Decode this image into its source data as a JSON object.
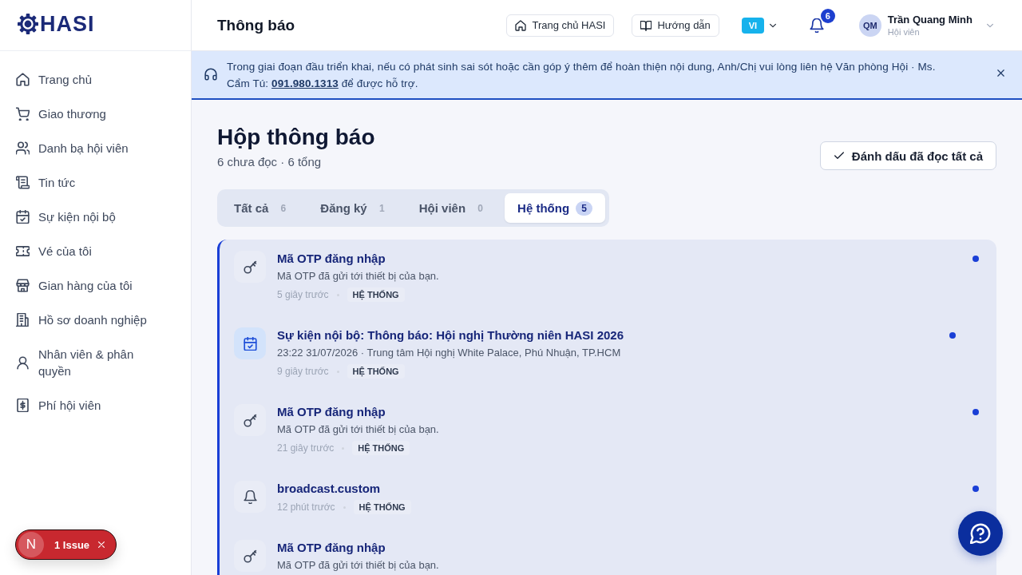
{
  "logo": {
    "text": "HASI"
  },
  "sidebar": {
    "items": [
      {
        "label": "Trang chủ",
        "selected": false
      },
      {
        "label": "Giao thương",
        "selected": false
      },
      {
        "label": "Danh bạ hội viên",
        "selected": false
      },
      {
        "label": "Tin tức",
        "selected": false
      },
      {
        "label": "Sự kiện nội bộ",
        "selected": false
      },
      {
        "label": "Vé của tôi",
        "selected": false
      },
      {
        "label": "Gian hàng của tôi",
        "selected": false
      },
      {
        "label": "Hồ sơ doanh nghiệp",
        "selected": false
      },
      {
        "label": "Nhân viên & phân quyền",
        "selected": false
      },
      {
        "label": "Phí hội viên",
        "selected": false
      }
    ]
  },
  "header": {
    "title": "Thông báo",
    "links": [
      {
        "label": "Trang chủ HASI"
      },
      {
        "label": "Hướng dẫn"
      }
    ],
    "language": "VI",
    "notification_count": "6",
    "user": {
      "initials": "QM",
      "name": "Trần Quang Minh",
      "role": "Hội viên"
    }
  },
  "banner": {
    "text_before": "Trong giai đoạn đầu triển khai, nếu có phát sinh sai sót hoặc cần góp ý thêm để hoàn thiện nội dung, Anh/Chị vui lòng liên hệ Văn phòng Hội · Ms. Cẩm Tú: ",
    "phone": "091.980.1313",
    "text_after": " để được hỗ trợ."
  },
  "inbox": {
    "title": "Hộp thông báo",
    "summary": "6 chưa đọc · 6 tổng",
    "mark_all_button": "Đánh dấu đã đọc tất cả",
    "tabs": [
      {
        "label": "Tất cả",
        "count": "6",
        "selected": false
      },
      {
        "label": "Đăng ký",
        "count": "1",
        "selected": false
      },
      {
        "label": "Hội viên",
        "count": "0",
        "selected": false
      },
      {
        "label": "Hệ thống",
        "count": "5",
        "selected": true
      }
    ],
    "notifications": [
      {
        "kind": "otp",
        "title": "Mã OTP đăng nhập",
        "body": "Mã OTP đã gửi tới thiết bị của bạn.",
        "time": "5 giây trước",
        "tag": "HỆ THỐNG",
        "unread": true
      },
      {
        "kind": "event",
        "title": "Sự kiện nội bộ: Thông báo: Hội nghị Thường niên HASI 2026",
        "body": "23:22 31/07/2026 · Trung tâm Hội nghị White Palace, Phú Nhuận, TP.HCM",
        "time": "9 giây trước",
        "tag": "HỆ THỐNG",
        "unread": true
      },
      {
        "kind": "otp",
        "title": "Mã OTP đăng nhập",
        "body": "Mã OTP đã gửi tới thiết bị của bạn.",
        "time": "21 giây trước",
        "tag": "HỆ THỐNG",
        "unread": true
      },
      {
        "kind": "broadcast",
        "title": "broadcast.custom",
        "time": "12 phút trước",
        "tag": "HỆ THỐNG",
        "unread": true
      },
      {
        "kind": "otp",
        "title": "Mã OTP đăng nhập",
        "body": "Mã OTP đã gửi tới thiết bị của bạn."
      }
    ]
  },
  "dev_overlay": {
    "logo": "N",
    "label": "1 Issue"
  }
}
